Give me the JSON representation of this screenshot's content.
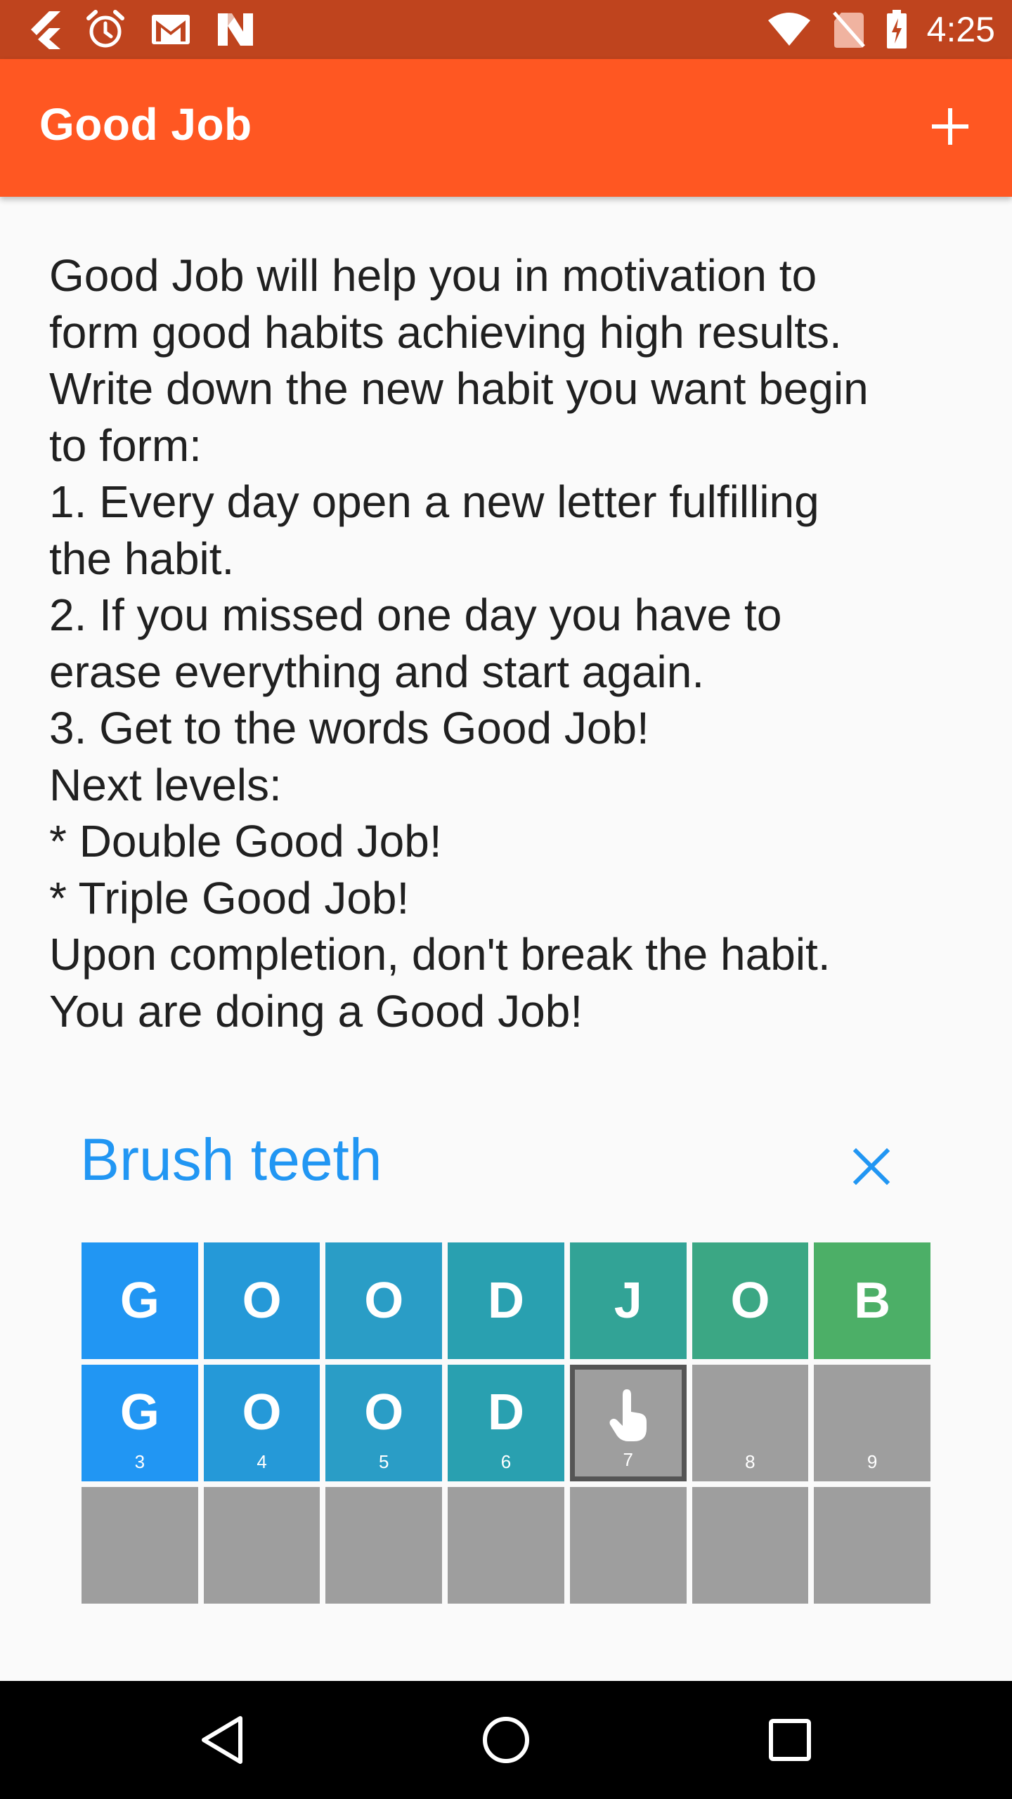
{
  "status_bar": {
    "time": "4:25",
    "left_icons": [
      "app-notification-icon",
      "alarm-icon",
      "gmail-icon",
      "n-app-icon"
    ],
    "right_icons": [
      "wifi-icon",
      "no-sim-icon",
      "battery-charging-icon"
    ]
  },
  "app_bar": {
    "title": "Good Job",
    "action_icon": "add-icon"
  },
  "intro_lines": [
    "Good Job will help you in motivation to",
    "form good habits achieving high results.",
    "Write down the new habit you want begin",
    "to form:",
    "1. Every day open a new letter fulfilling",
    "the habit.",
    "2. If you missed one day you have to",
    "erase everything and start again.",
    "3. Get to the words Good Job!",
    "Next levels:",
    "* Double Good Job!",
    "* Triple Good Job!",
    "Upon completion, don't break the habit.",
    "You are doing a Good Job!"
  ],
  "habit": {
    "title": "Brush teeth",
    "delete_icon": "close-icon",
    "rows": [
      [
        {
          "letter": "G",
          "num": "",
          "color": "#2196f3"
        },
        {
          "letter": "O",
          "num": "",
          "color": "#2599d8"
        },
        {
          "letter": "O",
          "num": "",
          "color": "#2a9dc6"
        },
        {
          "letter": "D",
          "num": "",
          "color": "#29a0b0"
        },
        {
          "letter": "J",
          "num": "",
          "color": "#32a396"
        },
        {
          "letter": "O",
          "num": "",
          "color": "#3ba784"
        },
        {
          "letter": "B",
          "num": "",
          "color": "#4caf67"
        }
      ],
      [
        {
          "letter": "G",
          "num": "3",
          "color": "#2196f3"
        },
        {
          "letter": "O",
          "num": "4",
          "color": "#2599d8"
        },
        {
          "letter": "O",
          "num": "5",
          "color": "#2a9dc6"
        },
        {
          "letter": "D",
          "num": "6",
          "color": "#29a0b0"
        },
        {
          "letter": "",
          "num": "7",
          "state": "current"
        },
        {
          "letter": "",
          "num": "8",
          "state": "empty"
        },
        {
          "letter": "",
          "num": "9",
          "state": "empty"
        }
      ],
      [
        {
          "letter": "",
          "num": "",
          "state": "empty"
        },
        {
          "letter": "",
          "num": "",
          "state": "empty"
        },
        {
          "letter": "",
          "num": "",
          "state": "empty"
        },
        {
          "letter": "",
          "num": "",
          "state": "empty"
        },
        {
          "letter": "",
          "num": "",
          "state": "empty"
        },
        {
          "letter": "",
          "num": "",
          "state": "empty"
        },
        {
          "letter": "",
          "num": "",
          "state": "empty"
        }
      ]
    ]
  },
  "nav_bar": {
    "buttons": [
      "back-icon",
      "home-icon",
      "recents-icon"
    ]
  },
  "colors": {
    "status_bar": "#bf441e",
    "app_bar": "#ff5722",
    "accent": "#2196f3",
    "empty_cell": "#9e9e9e",
    "current_border": "#555555"
  }
}
